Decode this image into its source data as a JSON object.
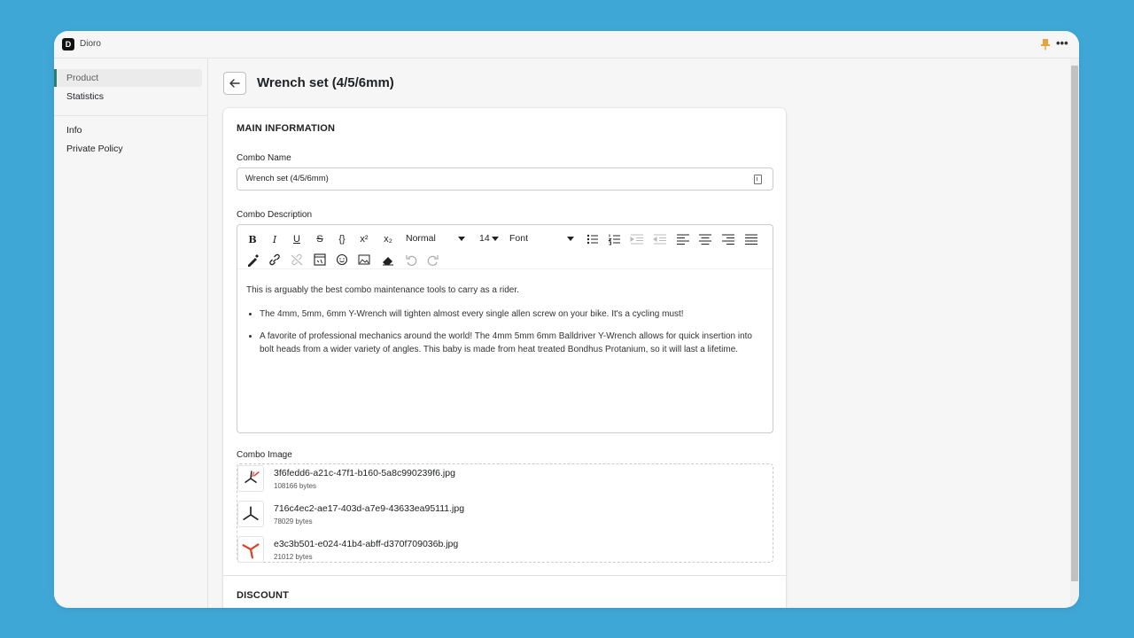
{
  "app": {
    "title": "Dioro",
    "logo_letter": "D"
  },
  "sidebar": {
    "items": [
      {
        "label": "Product"
      },
      {
        "label": "Statistics"
      },
      {
        "label": "Info"
      },
      {
        "label": "Private Policy"
      }
    ]
  },
  "page": {
    "title": "Wrench set (4/5/6mm)"
  },
  "main_info": {
    "section_title": "MAIN INFORMATION",
    "combo_name_label": "Combo Name",
    "combo_name_value": "Wrench set (4/5/6mm)",
    "combo_description_label": "Combo Description",
    "combo_image_label": "Combo Image"
  },
  "toolbar": {
    "bold": "B",
    "italic": "I",
    "underline": "U",
    "strikethrough": "S",
    "code": "{}",
    "superscript": "x²",
    "subscript": "x₂",
    "block_type": "Normal",
    "font_size": "14",
    "font_family": "Font"
  },
  "description": {
    "paragraph": "This is arguably the best combo maintenance tools to carry as a rider.",
    "bullets": [
      "The 4mm, 5mm, 6mm Y-Wrench will tighten almost every single allen screw on your bike. It's a cycling must!",
      "A favorite of professional mechanics around the world! The 4mm 5mm 6mm Balldriver Y-Wrench allows for quick insertion into bolt heads from a wider variety of angles. This baby is made from heat treated Bondhus Protanium, so it will last a lifetime."
    ]
  },
  "images": [
    {
      "name": "3f6fedd6-a21c-47f1-b160-5a8c990239f6.jpg",
      "size": "108166 bytes"
    },
    {
      "name": "716c4ec2-ae17-403d-a7e9-43633ea95111.jpg",
      "size": "78029 bytes"
    },
    {
      "name": "e3c3b501-e024-41b4-abff-d370f709036b.jpg",
      "size": "21012 bytes"
    }
  ],
  "discount": {
    "section_title": "DISCOUNT"
  },
  "colors": {
    "background": "#3fa7d6",
    "active_accent": "#2e7d6b",
    "pin": "#e8a33d",
    "thumb_red": "#d9412b"
  }
}
